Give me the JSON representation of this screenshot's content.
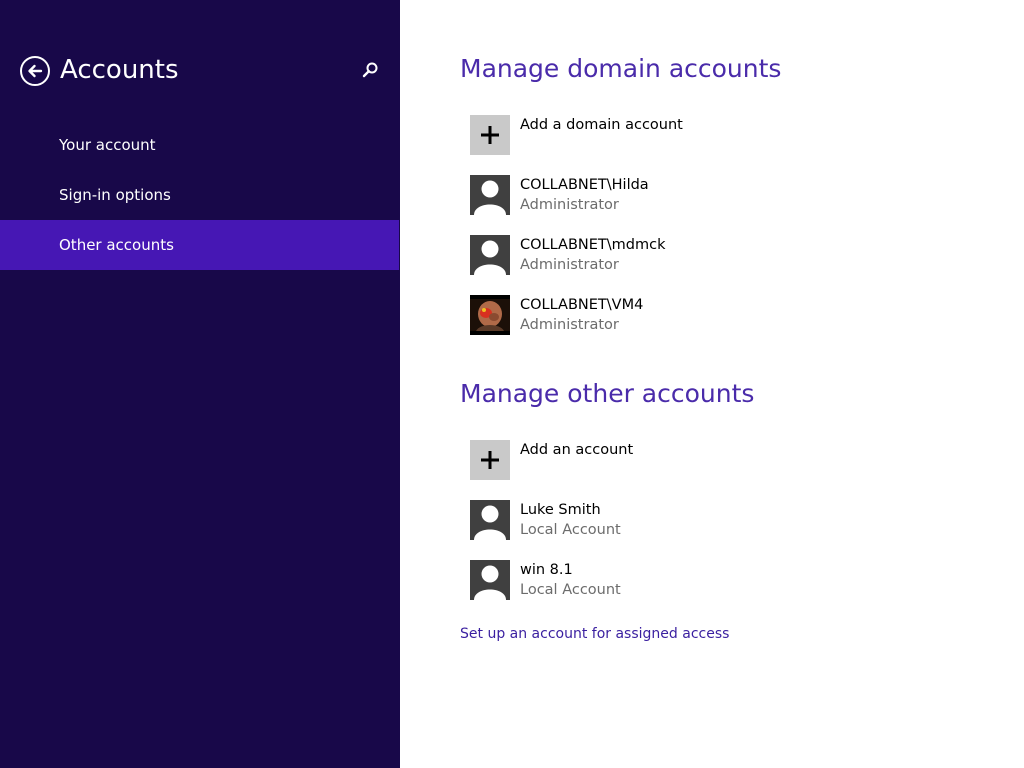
{
  "sidebar": {
    "title": "Accounts",
    "items": [
      {
        "label": "Your account"
      },
      {
        "label": "Sign-in options"
      },
      {
        "label": "Other accounts"
      }
    ]
  },
  "domain": {
    "title": "Manage domain accounts",
    "add_label": "Add a domain account",
    "accounts": [
      {
        "name": "COLLABNET\\Hilda",
        "role": "Administrator"
      },
      {
        "name": "COLLABNET\\mdmck",
        "role": "Administrator"
      },
      {
        "name": "COLLABNET\\VM4",
        "role": "Administrator"
      }
    ]
  },
  "other": {
    "title": "Manage other accounts",
    "add_label": "Add an account",
    "accounts": [
      {
        "name": "Luke Smith",
        "role": "Local Account"
      },
      {
        "name": "win 8.1",
        "role": "Local Account"
      }
    ]
  },
  "assigned_access_link": "Set up an account for assigned access",
  "colors": {
    "sidebar_bg": "#180849",
    "active_item_bg": "#4617b4",
    "heading": "#4a2baa",
    "link": "#3a1fa0"
  }
}
